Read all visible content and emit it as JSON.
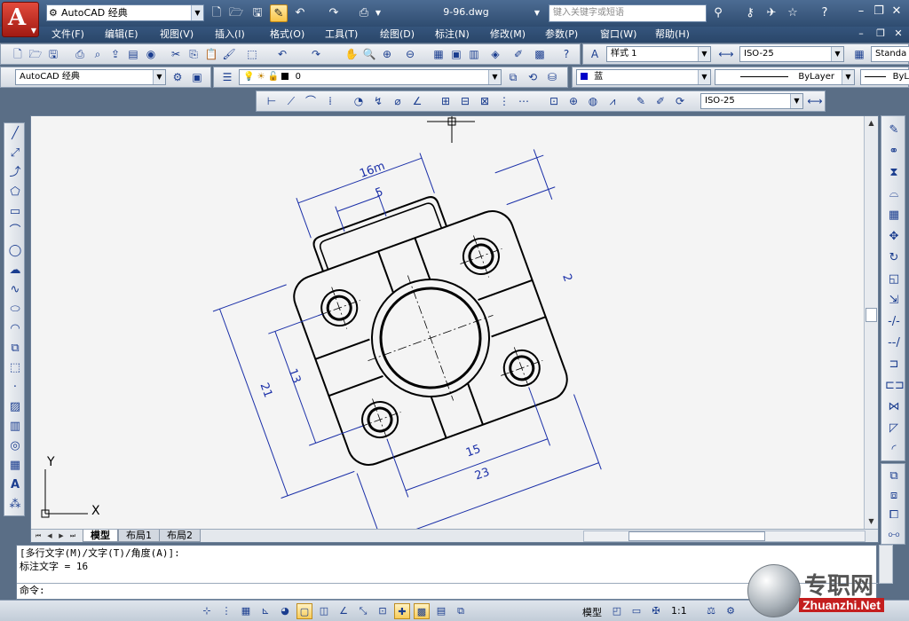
{
  "title_bar": {
    "workspace": "AutoCAD 经典",
    "document_title": "9-96.dwg",
    "search_placeholder": "键入关键字或短语"
  },
  "menu": [
    "文件(F)",
    "编辑(E)",
    "视图(V)",
    "插入(I)",
    "格式(O)",
    "工具(T)",
    "绘图(D)",
    "标注(N)",
    "修改(M)",
    "参数(P)",
    "窗口(W)",
    "帮助(H)"
  ],
  "styles_toolbar": {
    "text_style": "样式 1",
    "dim_style": "ISO-25",
    "table_style": "Standa"
  },
  "workspace_toolbar": {
    "workspace": "AutoCAD 经典"
  },
  "layer_toolbar": {
    "current_layer": "0"
  },
  "properties_toolbar": {
    "color": "蓝",
    "color_hex": "#0000c8",
    "linetype": "ByLayer",
    "lineweight": "ByL"
  },
  "dimension_toolbar": {
    "dim_style": "ISO-25"
  },
  "drawing": {
    "dimensions": [
      "16m",
      "5",
      "2",
      "21",
      "13",
      "15",
      "23"
    ],
    "ucs": {
      "x_label": "X",
      "y_label": "Y"
    },
    "dimension_color": "#1a2fa8",
    "object_color": "#000000"
  },
  "layout_tabs": [
    "模型",
    "布局1",
    "布局2"
  ],
  "command": {
    "history_1": "[多行文字(M)/文字(T)/角度(A)]:",
    "history_2": "标注文字 = 16",
    "prompt": "命令:"
  },
  "status": {
    "space": "模型",
    "annotation_scale": "1:1"
  },
  "watermark": {
    "cn": "专职网",
    "en": "Zhuanzhi.Net"
  }
}
